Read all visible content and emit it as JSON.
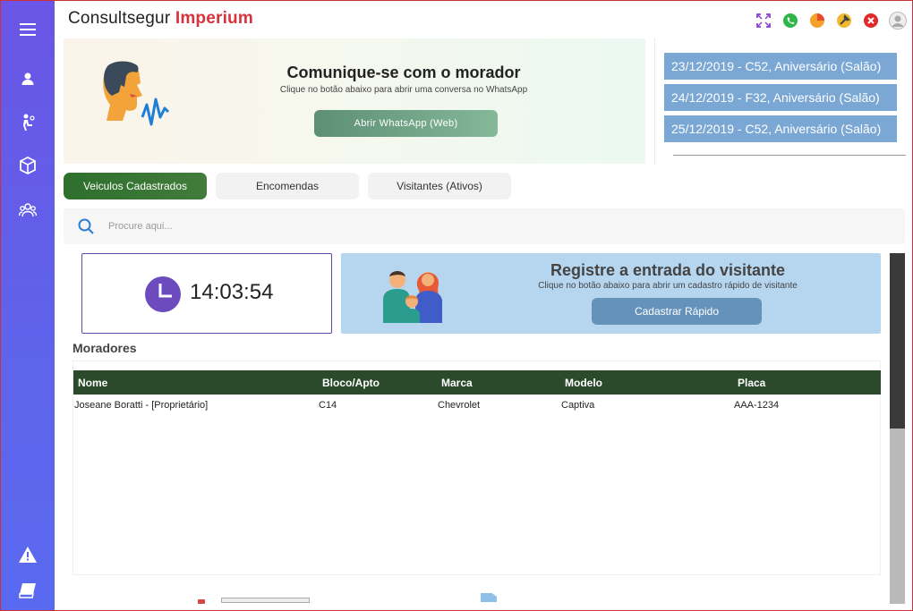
{
  "app": {
    "brand_main": "Consultsegur",
    "brand_accent": "Imperium"
  },
  "sidebar": {
    "items": [
      {
        "icon": "menu-icon"
      },
      {
        "icon": "user-icon"
      },
      {
        "icon": "visitor-icon"
      },
      {
        "icon": "package-icon"
      },
      {
        "icon": "group-icon"
      },
      {
        "icon": "alert-icon"
      },
      {
        "icon": "book-icon"
      }
    ]
  },
  "toolbar": {
    "icons": [
      "fullscreen-icon",
      "whatsapp-icon",
      "pie-chart-icon",
      "wrench-icon",
      "close-icon",
      "avatar-icon"
    ]
  },
  "whatsapp_card": {
    "title": "Comunique-se com o morador",
    "subtitle": "Clique no botão abaixo para abrir uma conversa no WhatsApp",
    "button_label": "Abrir WhatsApp (Web)"
  },
  "events": [
    "23/12/2019 - C52, Aniversário (Salão)",
    "24/12/2019 - F32, Aniversário (Salão)",
    "25/12/2019 - C52, Aniversário (Salão)"
  ],
  "tabs": [
    {
      "label": "Veiculos Cadastrados",
      "active": true
    },
    {
      "label": "Encomendas",
      "active": false
    },
    {
      "label": "Visitantes (Ativos)",
      "active": false
    }
  ],
  "search": {
    "placeholder": "Procure aqui...",
    "value": ""
  },
  "clock": {
    "time": "14:03:54"
  },
  "visitor_card": {
    "title": "Registre a entrada do visitante",
    "subtitle": "Clique no botão abaixo para abrir um cadastro rápido de visitante",
    "button_label": "Cadastrar Rápido"
  },
  "residents": {
    "title": "Moradores",
    "columns": [
      "Nome",
      "Bloco/Apto",
      "Marca",
      "Modelo",
      "Placa"
    ],
    "rows": [
      [
        "Joseane Boratti - [Proprietário]",
        "C14",
        "Chevrolet",
        "Captiva",
        "AAA-1234"
      ]
    ]
  },
  "colors": {
    "sidebar": "#6a55e6",
    "brand_accent": "#d8323c",
    "active_tab": "#2e6f2e",
    "table_header": "#2b4a2b",
    "event_bg": "#7aa7d4",
    "visitor_bg": "#b6d6f0",
    "clock_purple": "#6b4bbd"
  }
}
